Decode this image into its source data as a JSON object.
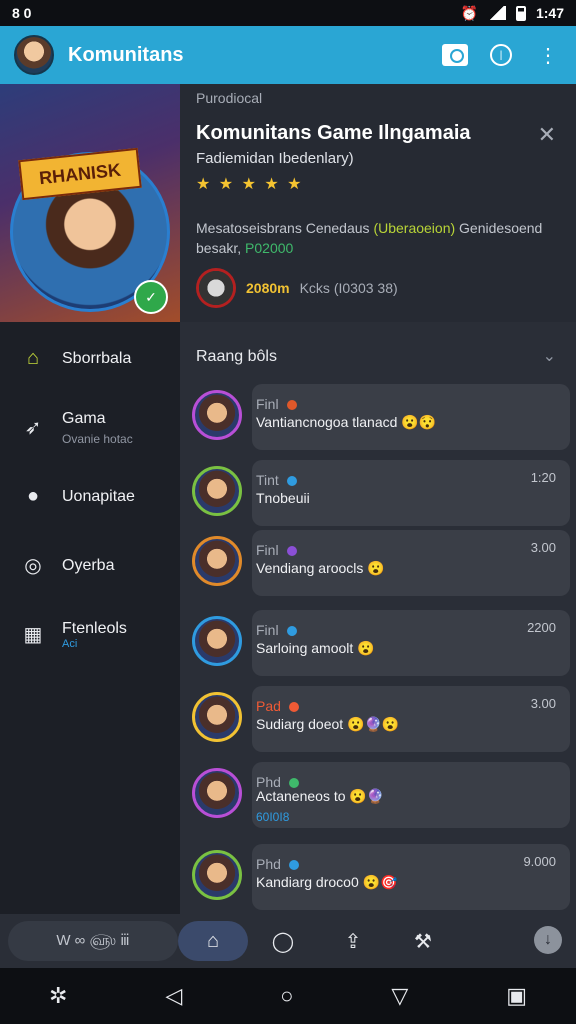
{
  "status": {
    "left": "8 0",
    "time": "1:47"
  },
  "appbar": {
    "title": "Komunitans"
  },
  "hero": {
    "label": "Purodiocal",
    "banner": "RHANISK",
    "title": "Komunitans Game Ilngamaia",
    "subtitle": "Fadiemidan Ibedenlary)",
    "rating": "★ ★ ★ ★ ★",
    "desc_part1": "Mesatoseisbrans Cenedaus ",
    "desc_highlight": "(Uberaoeion)",
    "desc_part2": " Genidesoend besakr, ",
    "desc_price": "P02000",
    "user_count": "2080m",
    "user_text": "Kcks (I0303 38)"
  },
  "sidebar": {
    "items": [
      {
        "label": "Sborrbala",
        "sub": ""
      },
      {
        "label": "Gama",
        "sub": "Ovanie hotac"
      },
      {
        "label": "Uonapitae",
        "sub": ""
      },
      {
        "label": "Oyerba",
        "sub": ""
      },
      {
        "label": "Ftenleols",
        "sub": "Aci"
      }
    ]
  },
  "content": {
    "header": "Raang bôls"
  },
  "messages": [
    {
      "name": "Finl",
      "text": "Vantiancnogoa tlanacd 😮😯",
      "time": "",
      "extra": "",
      "ring": "#b84fd6",
      "dot": "#e0582a",
      "nameColor": "gray"
    },
    {
      "name": "Tint",
      "text": "Tnobeuii",
      "time": "1:20",
      "extra": "",
      "ring": "#7ac142",
      "dot": "#2f9be0",
      "nameColor": "gray"
    },
    {
      "name": "Finl",
      "text": "Vendiang aroocls 😮",
      "time": "3.00",
      "extra": "",
      "ring": "#e08a2a",
      "dot": "#8b4fd6",
      "nameColor": "gray"
    },
    {
      "name": "Finl",
      "text": "Sarloing amoolt 😮",
      "time": "2200",
      "extra": "",
      "ring": "#2f9be0",
      "dot": "#2f9be0",
      "nameColor": "gray"
    },
    {
      "name": "Pad",
      "text": "Sudiarg doeot 😮🔮😮",
      "time": "3.00",
      "extra": "",
      "ring": "#f1c233",
      "dot": "#ef5a35",
      "nameColor": "red"
    },
    {
      "name": "Phd",
      "text": "Actaneneos to 😮🔮",
      "time": "",
      "extra": "60I0I8",
      "ring": "#b84fd6",
      "dot": "#3fb96b",
      "nameColor": "gray"
    },
    {
      "name": "Phd",
      "text": "Kandiarg droco0 😮🎯",
      "time": "9.000",
      "extra": "",
      "ring": "#7ac142",
      "dot": "#2f9be0",
      "nameColor": "gray"
    }
  ],
  "bottombar": {
    "pill": "W  ∞  ௵  ⅲ"
  }
}
